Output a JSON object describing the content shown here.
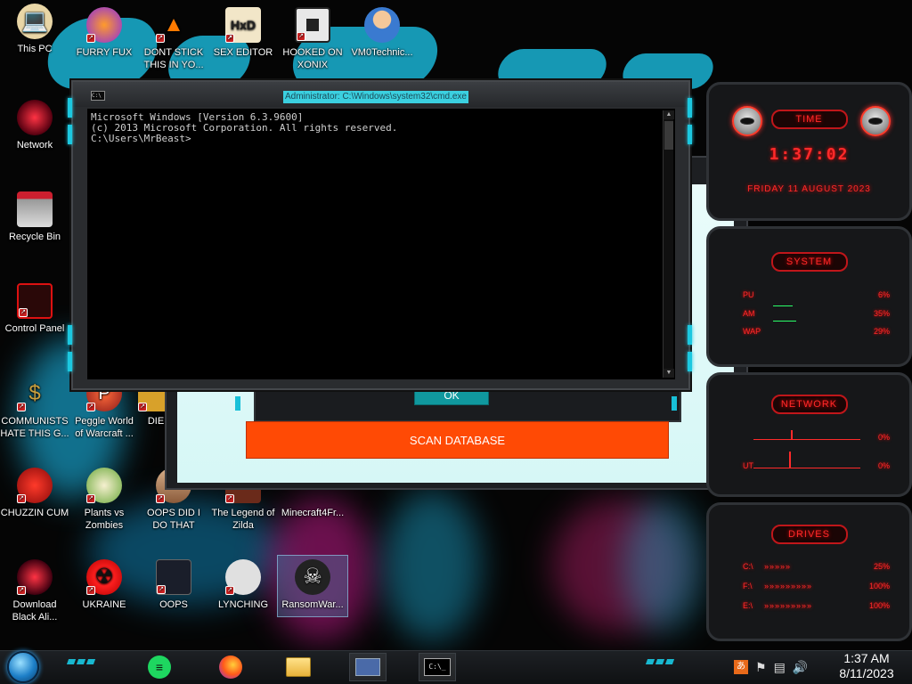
{
  "desktop": {
    "icons": [
      {
        "label": "This PC",
        "icon": "this-pc-icon"
      },
      {
        "label": "FURRY FUX",
        "icon": "firefox-icon"
      },
      {
        "label": "DONT STICK THIS IN YO...",
        "icon": "vlc-cone-icon"
      },
      {
        "label": "SEX EDITOR",
        "icon": "hxd-editor-icon"
      },
      {
        "label": "HOOKED ON XONIX",
        "icon": "xonix-game-icon"
      },
      {
        "label": "VM0Technic...",
        "icon": "doctor-avatar-icon"
      },
      {
        "label": "Network",
        "icon": "network-orb-icon"
      },
      {
        "label": "Recycle Bin",
        "icon": "recycle-bin-icon"
      },
      {
        "label": "Control Panel",
        "icon": "control-panel-icon"
      },
      {
        "label": "COMMUNISTS HATE THIS G...",
        "icon": "money-bag-icon"
      },
      {
        "label": "Peggle World of Warcraft ...",
        "icon": "peggle-icon"
      },
      {
        "label": "DIE",
        "icon": "die-file-icon"
      },
      {
        "label": "CHUZZIN CUM",
        "icon": "chuzzle-icon"
      },
      {
        "label": "Plants vs Zombies",
        "icon": "plants-vs-zombies-icon"
      },
      {
        "label": "OOPS DID I DO THAT",
        "icon": "portrait-icon"
      },
      {
        "label": "The Legend of Zilda",
        "icon": "zelda-icon"
      },
      {
        "label": "Minecraft4Fr...",
        "icon": "minecraft-icon"
      },
      {
        "label": "Download Black Ali...",
        "icon": "alienware-orb-icon"
      },
      {
        "label": "UKRAINE",
        "icon": "radiation-icon"
      },
      {
        "label": "OOPS",
        "icon": "dark-screen-icon"
      },
      {
        "label": "LYNCHING",
        "icon": "lantern-icon"
      },
      {
        "label": "RansomWar...",
        "icon": "skull-icon"
      }
    ]
  },
  "cmd_window": {
    "title": "Administrator: C:\\Windows\\system32\\cmd.exe",
    "lines": [
      "Microsoft Windows [Version 6.3.9600]",
      "(c) 2013 Microsoft Corporation. All rights reserved.",
      "",
      "C:\\Users\\MrBeast>"
    ]
  },
  "bg_app": {
    "ok_label": "OK",
    "scan_label": "SCAN DATABASE"
  },
  "gadgets": {
    "time": {
      "title": "TIME",
      "clock": "1:37:02",
      "date": "FRIDAY 11 AUGUST 2023"
    },
    "system": {
      "title": "SYSTEM",
      "rows": [
        {
          "label": "PU",
          "value": "6%"
        },
        {
          "label": "AM",
          "value": "35%"
        },
        {
          "label": "WAP",
          "value": "29%"
        }
      ]
    },
    "network": {
      "title": "NETWORK",
      "rows": [
        {
          "label": "",
          "value": "0%"
        },
        {
          "label": "UT",
          "value": "0%"
        }
      ]
    },
    "drives": {
      "title": "DRIVES",
      "rows": [
        {
          "label": "C:\\",
          "value": "25%"
        },
        {
          "label": "F:\\",
          "value": "100%"
        },
        {
          "label": "E:\\",
          "value": "100%"
        }
      ]
    }
  },
  "taskbar": {
    "apps": [
      {
        "icon": "spotify-icon"
      },
      {
        "icon": "firefox-icon"
      },
      {
        "icon": "file-explorer-icon"
      },
      {
        "icon": "app-window-icon"
      },
      {
        "icon": "cmd-icon"
      }
    ],
    "tray_icons": [
      "language-icon",
      "flag-icon",
      "network-icon",
      "volume-icon"
    ],
    "time": "1:37 AM",
    "date": "8/11/2023"
  },
  "colors": {
    "accent_cyan": "#18b8d0",
    "alert_red": "#ff2a2a",
    "scan_orange": "#ff4a05",
    "ok_teal": "#10989e"
  }
}
